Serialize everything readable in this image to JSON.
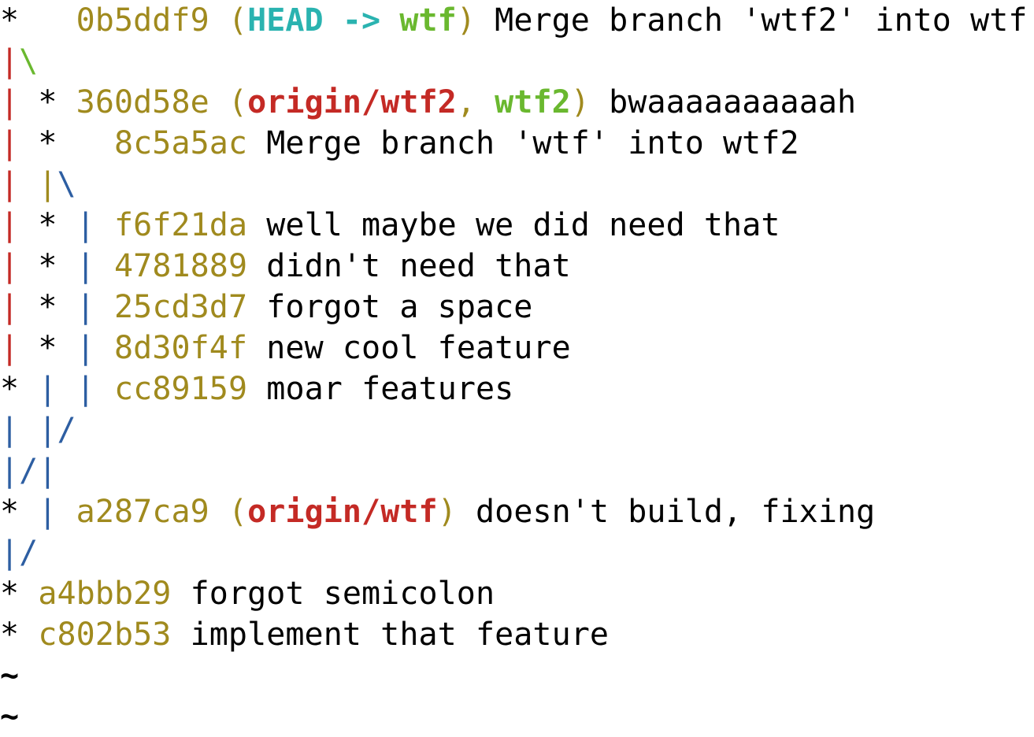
{
  "colors": {
    "default": "#000000",
    "hash": "#a08a1e",
    "head": "#2ab3b0",
    "branch_local": "#6ab82f",
    "branch_remote": "#c42a25",
    "graph_red": "#c42a25",
    "graph_green": "#6ab82f",
    "graph_blue": "#2d5ea2",
    "tilde": "#000000"
  },
  "log_lines": [
    {
      "segments": [
        {
          "text": "*   ",
          "color": "default"
        },
        {
          "text": "0b5ddf9 ",
          "color": "hash"
        },
        {
          "text": "(",
          "color": "hash"
        },
        {
          "text": "HEAD -> ",
          "color": "head",
          "bold": true
        },
        {
          "text": "wtf",
          "color": "branch_local",
          "bold": true
        },
        {
          "text": ") ",
          "color": "hash"
        },
        {
          "text": "Merge branch 'wtf2' into wtf",
          "color": "default"
        }
      ]
    },
    {
      "segments": [
        {
          "text": "|",
          "color": "graph_red"
        },
        {
          "text": "\\",
          "color": "graph_green"
        }
      ]
    },
    {
      "segments": [
        {
          "text": "|",
          "color": "graph_red"
        },
        {
          "text": " * ",
          "color": "default"
        },
        {
          "text": "360d58e ",
          "color": "hash"
        },
        {
          "text": "(",
          "color": "hash"
        },
        {
          "text": "origin/wtf2",
          "color": "branch_remote",
          "bold": true
        },
        {
          "text": ", ",
          "color": "hash"
        },
        {
          "text": "wtf2",
          "color": "branch_local",
          "bold": true
        },
        {
          "text": ") ",
          "color": "hash"
        },
        {
          "text": "bwaaaaaaaaaah",
          "color": "default"
        }
      ]
    },
    {
      "segments": [
        {
          "text": "|",
          "color": "graph_red"
        },
        {
          "text": " *   ",
          "color": "default"
        },
        {
          "text": "8c5a5ac ",
          "color": "hash"
        },
        {
          "text": "Merge branch 'wtf' into wtf2",
          "color": "default"
        }
      ]
    },
    {
      "segments": [
        {
          "text": "|",
          "color": "graph_red"
        },
        {
          "text": " ",
          "color": "default"
        },
        {
          "text": "|",
          "color": "hash"
        },
        {
          "text": "\\",
          "color": "graph_blue"
        }
      ]
    },
    {
      "segments": [
        {
          "text": "|",
          "color": "graph_red"
        },
        {
          "text": " * ",
          "color": "default"
        },
        {
          "text": "|",
          "color": "graph_blue"
        },
        {
          "text": " ",
          "color": "default"
        },
        {
          "text": "f6f21da ",
          "color": "hash"
        },
        {
          "text": "well maybe we did need that",
          "color": "default"
        }
      ]
    },
    {
      "segments": [
        {
          "text": "|",
          "color": "graph_red"
        },
        {
          "text": " * ",
          "color": "default"
        },
        {
          "text": "|",
          "color": "graph_blue"
        },
        {
          "text": " ",
          "color": "default"
        },
        {
          "text": "4781889 ",
          "color": "hash"
        },
        {
          "text": "didn't need that",
          "color": "default"
        }
      ]
    },
    {
      "segments": [
        {
          "text": "|",
          "color": "graph_red"
        },
        {
          "text": " * ",
          "color": "default"
        },
        {
          "text": "|",
          "color": "graph_blue"
        },
        {
          "text": " ",
          "color": "default"
        },
        {
          "text": "25cd3d7 ",
          "color": "hash"
        },
        {
          "text": "forgot a space",
          "color": "default"
        }
      ]
    },
    {
      "segments": [
        {
          "text": "|",
          "color": "graph_red"
        },
        {
          "text": " * ",
          "color": "default"
        },
        {
          "text": "|",
          "color": "graph_blue"
        },
        {
          "text": " ",
          "color": "default"
        },
        {
          "text": "8d30f4f ",
          "color": "hash"
        },
        {
          "text": "new cool feature",
          "color": "default"
        }
      ]
    },
    {
      "segments": [
        {
          "text": "* ",
          "color": "default"
        },
        {
          "text": "|",
          "color": "graph_blue"
        },
        {
          "text": " ",
          "color": "default"
        },
        {
          "text": "|",
          "color": "graph_blue"
        },
        {
          "text": " ",
          "color": "default"
        },
        {
          "text": "cc89159 ",
          "color": "hash"
        },
        {
          "text": "moar features",
          "color": "default"
        }
      ]
    },
    {
      "segments": [
        {
          "text": "|",
          "color": "graph_blue"
        },
        {
          "text": " ",
          "color": "default"
        },
        {
          "text": "|",
          "color": "graph_blue"
        },
        {
          "text": "/",
          "color": "graph_blue"
        }
      ]
    },
    {
      "segments": [
        {
          "text": "|",
          "color": "graph_blue"
        },
        {
          "text": "/",
          "color": "graph_blue"
        },
        {
          "text": "|",
          "color": "graph_blue"
        }
      ]
    },
    {
      "segments": [
        {
          "text": "* ",
          "color": "default"
        },
        {
          "text": "|",
          "color": "graph_blue"
        },
        {
          "text": " ",
          "color": "default"
        },
        {
          "text": "a287ca9 ",
          "color": "hash"
        },
        {
          "text": "(",
          "color": "hash"
        },
        {
          "text": "origin/wtf",
          "color": "branch_remote",
          "bold": true
        },
        {
          "text": ") ",
          "color": "hash"
        },
        {
          "text": "doesn't build, fixing",
          "color": "default"
        }
      ]
    },
    {
      "segments": [
        {
          "text": "|",
          "color": "graph_blue"
        },
        {
          "text": "/",
          "color": "graph_blue"
        }
      ]
    },
    {
      "segments": [
        {
          "text": "* ",
          "color": "default"
        },
        {
          "text": "a4bbb29 ",
          "color": "hash"
        },
        {
          "text": "forgot semicolon",
          "color": "default"
        }
      ]
    },
    {
      "segments": [
        {
          "text": "* ",
          "color": "default"
        },
        {
          "text": "c802b53 ",
          "color": "hash"
        },
        {
          "text": "implement that feature",
          "color": "default"
        }
      ]
    },
    {
      "segments": [
        {
          "text": "~",
          "color": "tilde",
          "bold": true
        }
      ]
    },
    {
      "segments": [
        {
          "text": "~",
          "color": "tilde",
          "bold": true
        }
      ]
    }
  ]
}
